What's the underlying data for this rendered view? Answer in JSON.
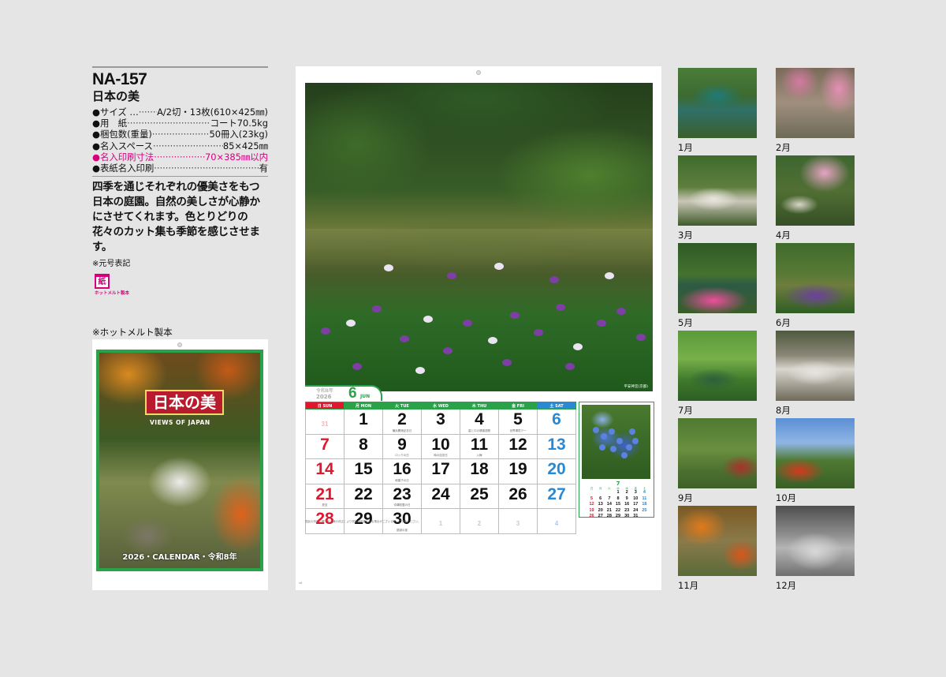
{
  "product": {
    "code": "NA-157",
    "title": "日本の美",
    "specs": [
      {
        "label": "●サイズ …",
        "value": "A/2切・13枚(610×425㎜)",
        "highlight": false
      },
      {
        "label": "●用　紙",
        "value": "コート70.5kg",
        "highlight": false
      },
      {
        "label": "●梱包数(重量)",
        "value": "50冊入(23kg)",
        "highlight": false
      },
      {
        "label": "●名入スペース",
        "value": "85×425㎜",
        "highlight": false
      },
      {
        "label": "●名入印刷寸法",
        "value": "70×385㎜以内",
        "highlight": true
      },
      {
        "label": "●表紙名入印刷",
        "value": "有",
        "highlight": false
      }
    ],
    "description": "四季を通じそれぞれの優美さをもつ日本の庭園。自然の美しさが心静かにさせてくれます。色とりどりの花々のカット集も季節を感じさせます。",
    "note": "※元号表記",
    "badge": {
      "mark": "紙",
      "caption": "ホットメルト製本"
    },
    "hotmelt_note": "※ホットメルト製本",
    "accent_color": "#d6007f",
    "green_color": "#2aa24a"
  },
  "cover": {
    "logo": "日本の美",
    "subtitle": "VIEWS OF JAPAN",
    "footer": "2026・CALENDAR・令和8年"
  },
  "calendar": {
    "year_label": "令和8年",
    "year": "2026",
    "month": "6",
    "month_en": "JUN",
    "photo_credit": "平安神宮(京都)",
    "weekdays": [
      "日 SUN",
      "月 MON",
      "火 TUE",
      "水 WED",
      "木 THU",
      "金 FRI",
      "土 SAT"
    ],
    "weeks": [
      [
        {
          "d": "31",
          "out": true
        },
        {
          "d": "1"
        },
        {
          "d": "2",
          "note": "横浜開港記念日"
        },
        {
          "d": "3"
        },
        {
          "d": "4",
          "note": "歯と口の健康週間"
        },
        {
          "d": "5",
          "note": "世界環境デー"
        },
        {
          "d": "6"
        }
      ],
      [
        {
          "d": "7"
        },
        {
          "d": "8"
        },
        {
          "d": "9",
          "note": "ロックの日"
        },
        {
          "d": "10",
          "note": "時の記念日"
        },
        {
          "d": "11",
          "note": "入梅"
        },
        {
          "d": "12"
        },
        {
          "d": "13"
        }
      ],
      [
        {
          "d": "14"
        },
        {
          "d": "15"
        },
        {
          "d": "16",
          "note": "和菓子の日"
        },
        {
          "d": "17"
        },
        {
          "d": "18"
        },
        {
          "d": "19"
        },
        {
          "d": "20"
        }
      ],
      [
        {
          "d": "21",
          "note": "夏至"
        },
        {
          "d": "22"
        },
        {
          "d": "23",
          "note": "沖縄慰霊の日"
        },
        {
          "d": "24"
        },
        {
          "d": "25"
        },
        {
          "d": "26"
        },
        {
          "d": "27"
        }
      ],
      [
        {
          "d": "28"
        },
        {
          "d": "29"
        },
        {
          "d": "30",
          "note": "夏越の祓"
        },
        {
          "d": "1",
          "out": true
        },
        {
          "d": "2",
          "out": true
        },
        {
          "d": "3",
          "out": true
        },
        {
          "d": "4",
          "out": true
        }
      ]
    ],
    "mini": {
      "month": "7",
      "weekdays": [
        "日",
        "月",
        "火",
        "水",
        "木",
        "金",
        "土"
      ],
      "days": [
        "",
        "",
        "",
        "1",
        "2",
        "3",
        "4",
        "5",
        "6",
        "7",
        "8",
        "9",
        "10",
        "11",
        "12",
        "13",
        "14",
        "15",
        "16",
        "17",
        "18",
        "19",
        "20",
        "21",
        "22",
        "23",
        "24",
        "25",
        "26",
        "27",
        "28",
        "29",
        "30",
        "31",
        ""
      ]
    },
    "fine_print": "国民の祝日に関する法律の改正により祝日が変更になる場合がございます。ご了承ください。",
    "page_mark": "v6"
  },
  "thumbnails": [
    {
      "label": "1月"
    },
    {
      "label": "2月"
    },
    {
      "label": "3月"
    },
    {
      "label": "4月"
    },
    {
      "label": "5月"
    },
    {
      "label": "6月"
    },
    {
      "label": "7月"
    },
    {
      "label": "8月"
    },
    {
      "label": "9月"
    },
    {
      "label": "10月"
    },
    {
      "label": "11月"
    },
    {
      "label": "12月"
    }
  ]
}
